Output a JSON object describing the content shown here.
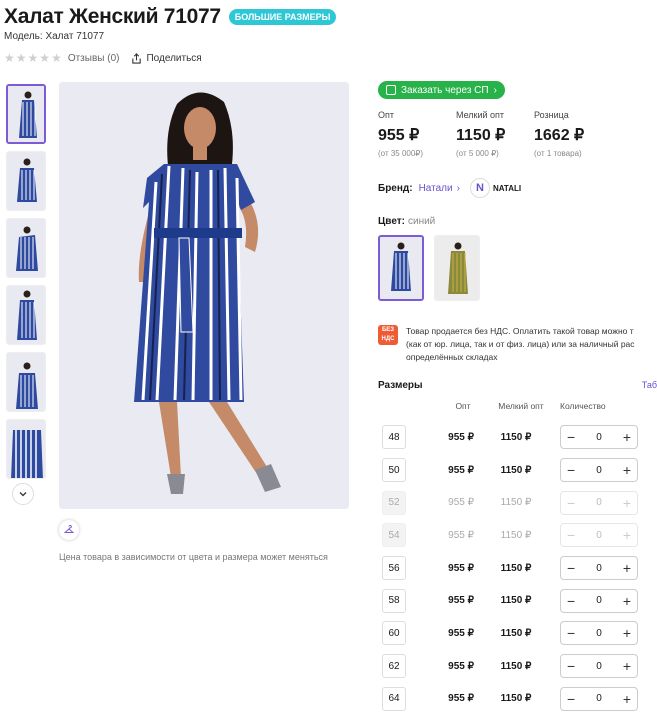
{
  "product": {
    "title": "Халат Женский 71077",
    "badge": "БОЛЬШИЕ РАЗМЕРЫ",
    "model": "Модель: Халат 71077",
    "reviews": "Отзывы (0)",
    "share": "Поделиться",
    "rating": 0
  },
  "gallery": {
    "price_note": "Цена товара в зависимости от цвета и размера может меняться"
  },
  "order": {
    "label": "Заказать через СП"
  },
  "prices": [
    {
      "label": "Опт",
      "value": "955 ₽",
      "sub": "(от 35 000₽)"
    },
    {
      "label": "Мелкий опт",
      "value": "1150 ₽",
      "sub": "(от 5 000 ₽)"
    },
    {
      "label": "Розница",
      "value": "1662 ₽",
      "sub": "(от 1 товара)"
    }
  ],
  "brand": {
    "label": "Бренд:",
    "name": "Натали",
    "logo_letter": "N",
    "logo_text": "NATALI"
  },
  "color": {
    "label": "Цвет:",
    "value": "синий"
  },
  "nds": {
    "badge_top": "БЕЗ",
    "badge_bottom": "НДС",
    "line1": "Товар продается без НДС. Оплатить такой товар можно т",
    "line2": "(как от юр. лица, так и от физ. лица) или за наличный рас",
    "line3": "определённых складах"
  },
  "sizes": {
    "title": "Размеры",
    "tab": "Таб",
    "headers": {
      "opt": "Опт",
      "small": "Мелкий опт",
      "qty": "Количество"
    },
    "rows": [
      {
        "size": "48",
        "opt": "955 ₽",
        "small": "1150 ₽",
        "qty": "0",
        "available": true
      },
      {
        "size": "50",
        "opt": "955 ₽",
        "small": "1150 ₽",
        "qty": "0",
        "available": true
      },
      {
        "size": "52",
        "opt": "955 ₽",
        "small": "1150 ₽",
        "qty": "0",
        "available": false
      },
      {
        "size": "54",
        "opt": "955 ₽",
        "small": "1150 ₽",
        "qty": "0",
        "available": false
      },
      {
        "size": "56",
        "opt": "955 ₽",
        "small": "1150 ₽",
        "qty": "0",
        "available": true
      },
      {
        "size": "58",
        "opt": "955 ₽",
        "small": "1150 ₽",
        "qty": "0",
        "available": true
      },
      {
        "size": "60",
        "opt": "955 ₽",
        "small": "1150 ₽",
        "qty": "0",
        "available": true
      },
      {
        "size": "62",
        "opt": "955 ₽",
        "small": "1150 ₽",
        "qty": "0",
        "available": true
      },
      {
        "size": "64",
        "opt": "955 ₽",
        "small": "1150 ₽",
        "qty": "0",
        "available": true
      }
    ]
  },
  "colors": {
    "accent": "#7b5bd6",
    "badge": "#2ec7d6",
    "order": "#27b24a",
    "nds": "#ef5b34"
  }
}
